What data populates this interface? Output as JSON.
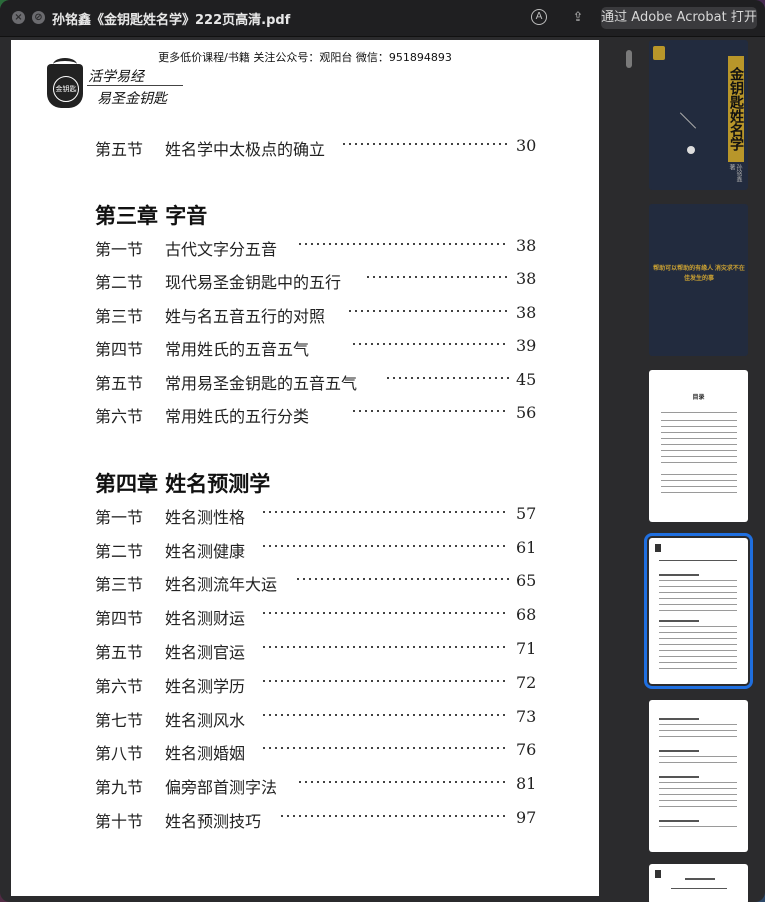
{
  "window": {
    "title": "孙铭鑫《金钥匙姓名学》222页高清.pdf",
    "open_button": "通过 Adobe Acrobat 打开"
  },
  "toolbar": {
    "close_icon": "close-icon",
    "minimize_icon": "minimize-icon",
    "annotate_icon": "markup-icon",
    "share_icon": "share-icon"
  },
  "page": {
    "header_note": "更多低价课程/书籍  关注公众号：观阳台   微信：951894893",
    "logo_text": "金钥匙",
    "slogan_line1": "活学易经",
    "slogan_line2": "易圣金钥匙",
    "toc": {
      "prev_rows": [
        {
          "section": "第五节",
          "name": "姓名学中太极点的确立",
          "page": "30"
        }
      ],
      "chapters": [
        {
          "title": "第三章  字音",
          "rows": [
            {
              "section": "第一节",
              "name": "古代文字分五音",
              "page": "38"
            },
            {
              "section": "第二节",
              "name": "现代易圣金钥匙中的五行",
              "page": "38"
            },
            {
              "section": "第三节",
              "name": "姓与名五音五行的对照",
              "page": "38"
            },
            {
              "section": "第四节",
              "name": "常用姓氏的五音五气",
              "page": "39"
            },
            {
              "section": "第五节",
              "name": "常用易圣金钥匙的五音五气",
              "page": "45"
            },
            {
              "section": "第六节",
              "name": "常用姓氏的五行分类",
              "page": "56"
            }
          ]
        },
        {
          "title": "第四章  姓名预测学",
          "rows": [
            {
              "section": "第一节",
              "name": "姓名测性格",
              "page": "57"
            },
            {
              "section": "第二节",
              "name": "姓名测健康",
              "page": "61"
            },
            {
              "section": "第三节",
              "name": "姓名测流年大运",
              "page": "65"
            },
            {
              "section": "第四节",
              "name": "姓名测财运",
              "page": "68"
            },
            {
              "section": "第五节",
              "name": "姓名测官运",
              "page": "71"
            },
            {
              "section": "第六节",
              "name": "姓名测学历",
              "page": "72"
            },
            {
              "section": "第七节",
              "name": "姓名测风水",
              "page": "73"
            },
            {
              "section": "第八节",
              "name": "姓名测婚姻",
              "page": "76"
            },
            {
              "section": "第九节",
              "name": "偏旁部首测字法",
              "page": "81"
            },
            {
              "section": "第十节",
              "name": "姓名预测技巧",
              "page": "97"
            }
          ]
        }
      ]
    }
  },
  "thumbnails": {
    "cover_title": "金钥匙姓名学",
    "cover_author": "孙铭鑫 著",
    "page2_text": "帮助可以帮助的有缘人 消灾求不在佳发生的事",
    "page3_title": "目录",
    "selected_index": 3
  }
}
